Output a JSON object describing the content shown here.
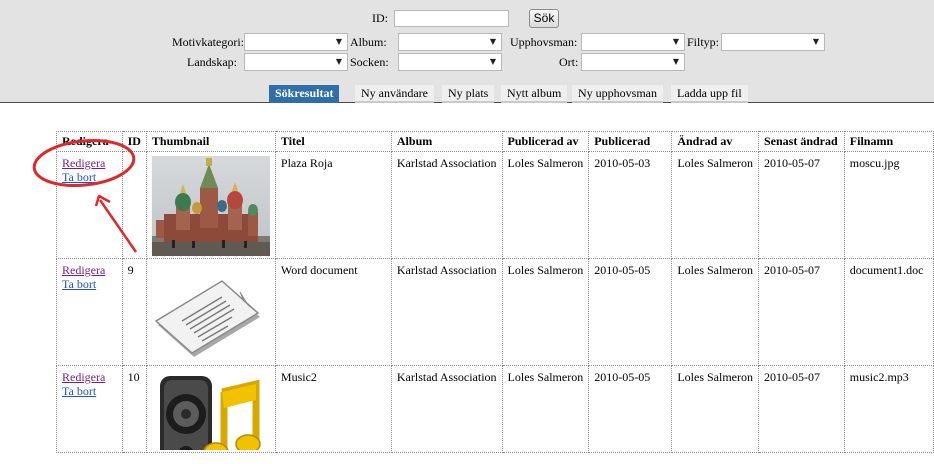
{
  "search": {
    "id_label": "ID:",
    "id_value": "",
    "search_button": "Sök",
    "motivkategori_label": "Motivkategori:",
    "album_label": "Album:",
    "upphovsman_label": "Upphovsman:",
    "filtyp_label": "Filtyp:",
    "landskap_label": "Landskap:",
    "socken_label": "Socken:",
    "ort_label": "Ort:",
    "motivkategori_value": "",
    "album_value": "",
    "upphovsman_value": "",
    "filtyp_value": "",
    "landskap_value": "",
    "socken_value": "",
    "ort_value": ""
  },
  "tabs": [
    {
      "label": "Sökresultat",
      "active": true
    },
    {
      "label": "Ny användare"
    },
    {
      "label": "Ny plats"
    },
    {
      "label": "Nytt album"
    },
    {
      "label": "Ny upphovsman"
    },
    {
      "label": "Ladda upp fil"
    }
  ],
  "table": {
    "headers": [
      "Redigera",
      "ID",
      "Thumbnail",
      "Titel",
      "Album",
      "Publicerad av",
      "Publicerad",
      "Ändrad av",
      "Senast ändrad",
      "Filnamn"
    ],
    "edit_label": "Redigera",
    "delete_label": "Ta bort",
    "rows": [
      {
        "id": "",
        "thumbnail": "cathedral-photo",
        "titel": "Plaza Roja",
        "album": "Karlstad Association",
        "publicerad_av": "Loles Salmeron",
        "publicerad": "2010-05-03",
        "andrad_av": "Loles Salmeron",
        "senast_andrad": "2010-05-07",
        "filnamn": "moscu.jpg"
      },
      {
        "id": "9",
        "thumbnail": "document-icon",
        "titel": "Word document",
        "album": "Karlstad Association",
        "publicerad_av": "Loles Salmeron",
        "publicerad": "2010-05-05",
        "andrad_av": "Loles Salmeron",
        "senast_andrad": "2010-05-07",
        "filnamn": "document1.doc"
      },
      {
        "id": "10",
        "thumbnail": "speaker-music-icon",
        "titel": "Music2",
        "album": "Karlstad Association",
        "publicerad_av": "Loles Salmeron",
        "publicerad": "2010-05-05",
        "andrad_av": "Loles Salmeron",
        "senast_andrad": "2010-05-07",
        "filnamn": "music2.mp3"
      }
    ]
  },
  "colors": {
    "panel_bg": "#e3e3e3",
    "active_tab": "#2f6fa8",
    "annotation": "#e0282a",
    "link": "#1e4fd6",
    "visited_link": "#7a1e86"
  }
}
